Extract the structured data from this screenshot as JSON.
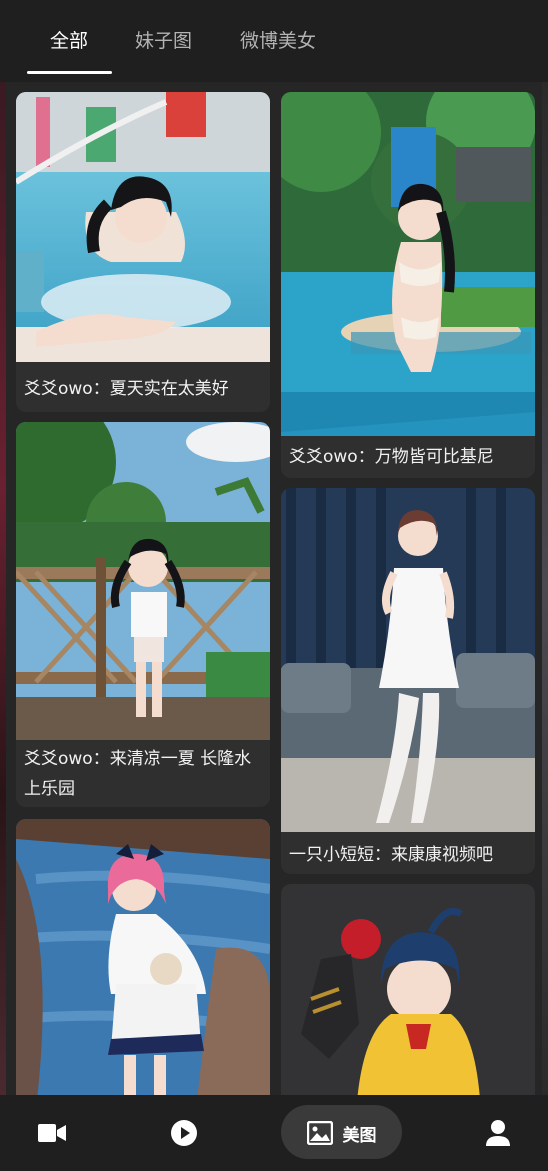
{
  "tabs": [
    {
      "label": "全部",
      "active": true
    },
    {
      "label": "妹子图",
      "active": false
    },
    {
      "label": "微博美女",
      "active": false
    }
  ],
  "feed": {
    "cards": [
      {
        "caption": "爻爻owo：夏天实在太美好",
        "scene": "pool"
      },
      {
        "caption": "爻爻owo：万物皆可比基尼",
        "scene": "waterpark"
      },
      {
        "caption": "爻爻owo：来清凉一夏 长隆水上乐园",
        "scene": "fence"
      },
      {
        "caption": "一只小短短：来康康视频吧",
        "scene": "sofa"
      },
      {
        "caption": "",
        "scene": "wood"
      },
      {
        "caption": "",
        "scene": "studio"
      }
    ]
  },
  "bottom_nav": {
    "items": [
      {
        "icon": "video-camera-icon",
        "label": ""
      },
      {
        "icon": "play-circle-icon",
        "label": ""
      },
      {
        "icon": "image-icon",
        "label": "美图",
        "active": true
      },
      {
        "icon": "user-icon",
        "label": ""
      }
    ]
  }
}
